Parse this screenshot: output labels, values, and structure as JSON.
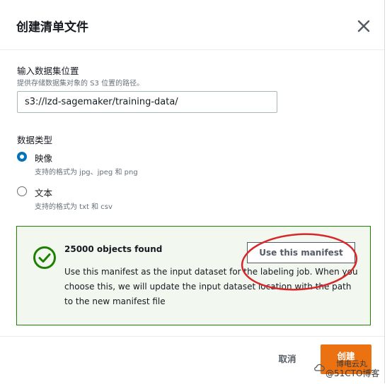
{
  "dialog": {
    "title": "创建清单文件",
    "close_icon": "close-icon"
  },
  "location": {
    "label": "输入数据集位置",
    "description": "提供存储数据集对象的 S3 位置的路径。",
    "value": "s3://lzd-sagemaker/training-data/"
  },
  "data_type": {
    "label": "数据类型",
    "options": [
      {
        "label": "映像",
        "description": "支持的格式为 jpg、jpeg 和 png",
        "selected": true
      },
      {
        "label": "文本",
        "description": "支持的格式为 txt 和 csv",
        "selected": false
      }
    ]
  },
  "alert": {
    "icon": "check-circle-icon",
    "title": "25000 objects found",
    "button_label": "Use this manifest",
    "body": "Use this manifest as the input dataset for the labeling job. When you choose this, we will update the input dataset location with the path to the new manifest file",
    "color": "#1d8102"
  },
  "footer": {
    "cancel_label": "取消",
    "create_label": "创建",
    "accent": "#ec7211"
  },
  "watermark": {
    "line1": "博电云丸",
    "line2": "@51CTO博客"
  }
}
